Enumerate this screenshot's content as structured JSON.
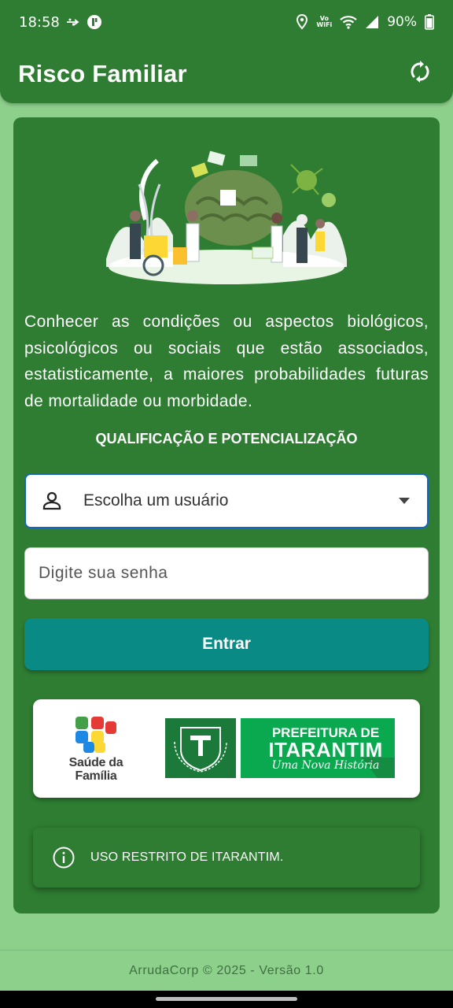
{
  "status_bar": {
    "time": "18:58",
    "icons_left": [
      "usb-icon",
      "app-notification-icon"
    ],
    "icons_right": [
      "location-icon",
      "vowifi-icon",
      "wifi-icon",
      "cell-signal-icon"
    ],
    "vowifi_top": "Vo",
    "vowifi_bottom": "WiFi",
    "battery": "90%"
  },
  "app_bar": {
    "title": "Risco Familiar",
    "action_icon": "refresh-icon"
  },
  "card": {
    "description": "Conhecer as condições ou aspectos biológicos, psicológicos ou sociais que estão associados, estatisticamente, a maiores probabilidades futuras de mortalidade ou morbidade.",
    "subtitle": "QUALIFICAÇÃO E POTENCIALIZAÇÃO"
  },
  "form": {
    "user_select_label": "Escolha um usuário",
    "password_placeholder": "Digite sua senha",
    "login_button": "Entrar"
  },
  "logos": {
    "saude_line1": "Saúde da",
    "saude_line2": "Família",
    "prefeitura_line1": "PREFEITURA DE",
    "prefeitura_line2": "ITARANTIM",
    "prefeitura_line3": "Uma Nova História"
  },
  "notice": {
    "icon": "info-icon",
    "text": "USO RESTRITO DE ITARANTIM."
  },
  "footer": {
    "text": "ArrudaCorp © 2025 - Versão 1.0"
  },
  "colors": {
    "primary": "#2e7d32",
    "background": "#8dd08c",
    "button": "#0a8a85",
    "focus_border": "#1565c0"
  }
}
